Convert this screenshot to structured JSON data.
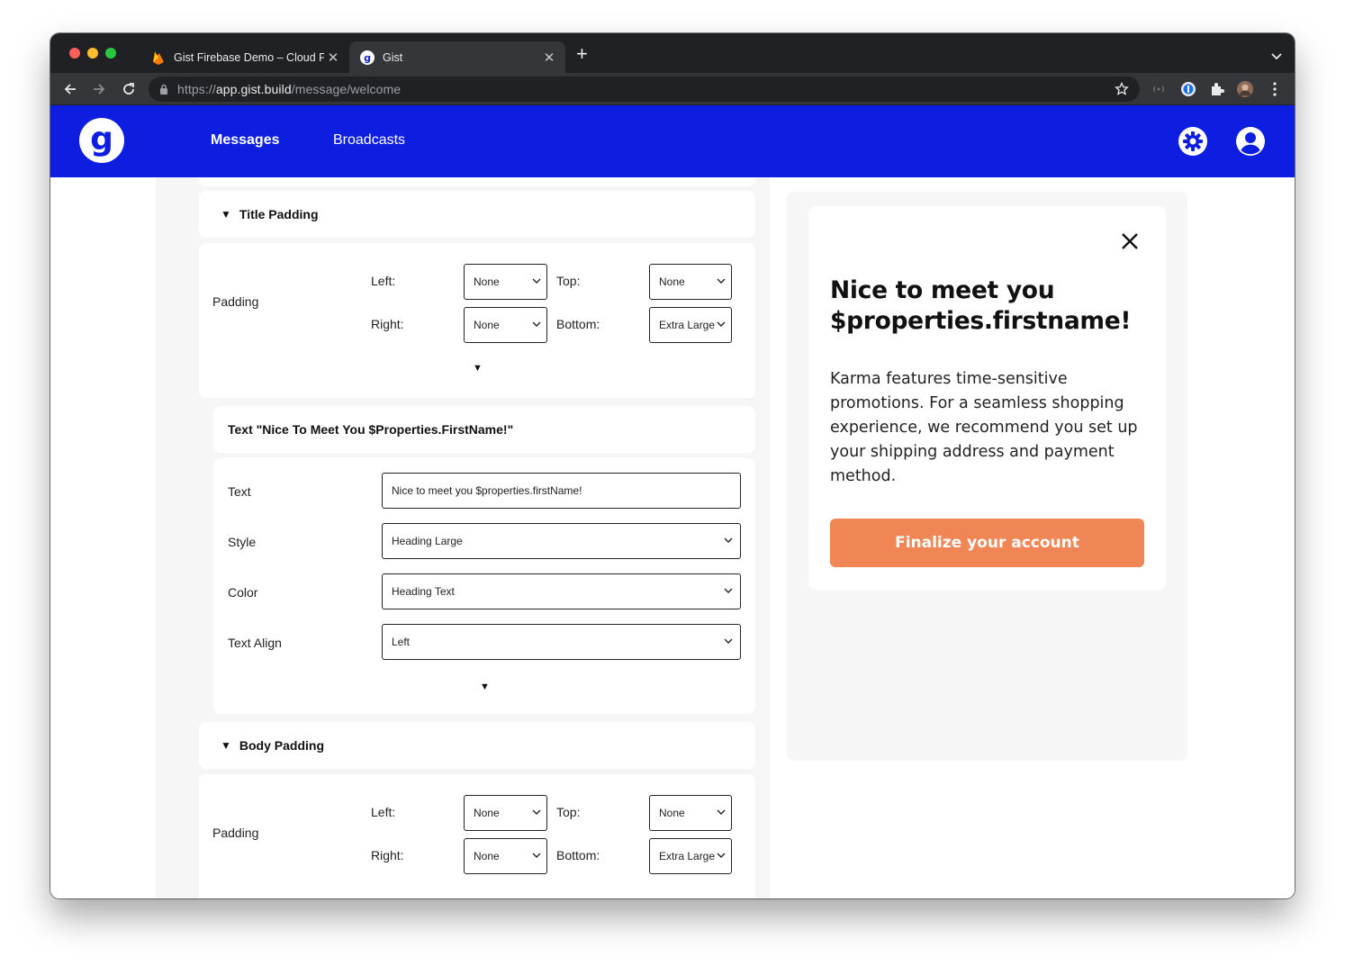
{
  "browser": {
    "tabs": [
      {
        "title": "Gist Firebase Demo – Cloud Fir",
        "icon": "firebase-icon",
        "active": false
      },
      {
        "title": "Gist",
        "icon": "gist-favicon",
        "active": true
      }
    ],
    "close_glyph": "✕",
    "new_tab_glyph": "+",
    "url_scheme": "https://",
    "url_host": "app.gist.build",
    "url_path": "/message/welcome"
  },
  "app": {
    "logo_letter": "g",
    "nav": {
      "messages": "Messages",
      "broadcasts": "Broadcasts"
    },
    "brand_color": "#0e1ee1"
  },
  "editor": {
    "title_padding": {
      "heading": "Title Padding",
      "label": "Padding",
      "left_label": "Left:",
      "left_value": "None",
      "top_label": "Top:",
      "top_value": "None",
      "right_label": "Right:",
      "right_value": "None",
      "bottom_label": "Bottom:",
      "bottom_value": "Extra Large"
    },
    "text_block": {
      "heading": "Text \"Nice To Meet You $Properties.FirstName!\"",
      "text_label": "Text",
      "text_value": "Nice to meet you $properties.firstName!",
      "style_label": "Style",
      "style_value": "Heading Large",
      "color_label": "Color",
      "color_value": "Heading Text",
      "align_label": "Text Align",
      "align_value": "Left"
    },
    "body_padding": {
      "heading": "Body Padding",
      "label": "Padding",
      "left_label": "Left:",
      "left_value": "None",
      "top_label": "Top:",
      "top_value": "None",
      "right_label": "Right:",
      "right_value": "None",
      "bottom_label": "Bottom:",
      "bottom_value": "Extra Large"
    },
    "expand_glyph": "▼"
  },
  "preview": {
    "title": "Nice to meet you $properties.firstname!",
    "body": "Karma features time-sensitive promotions. For a seamless shopping experience, we recommend you set up your shipping address and payment method.",
    "cta": "Finalize your account",
    "cta_color": "#f08655"
  }
}
